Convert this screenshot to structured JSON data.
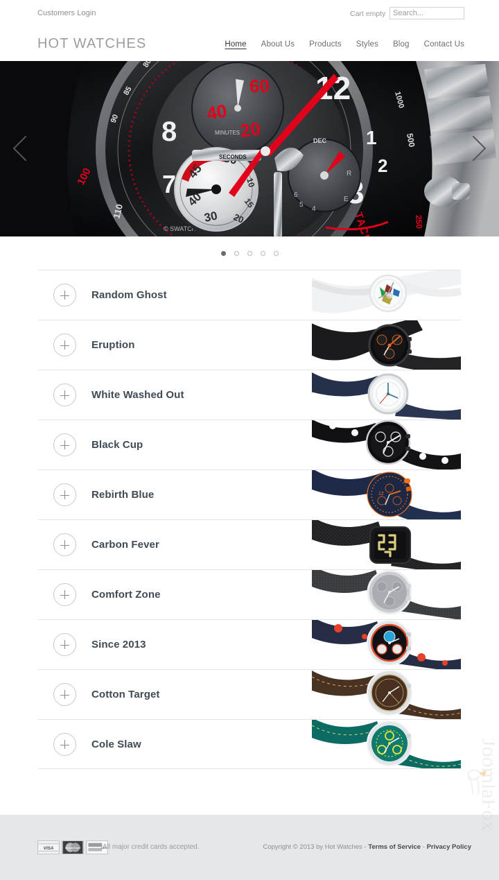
{
  "topbar": {
    "customers_login": "Customers Login",
    "cart_status": "Cart empty",
    "search_placeholder": "Search..."
  },
  "header": {
    "logo": "HOT WATCHES",
    "nav": [
      {
        "label": "Home",
        "active": true
      },
      {
        "label": "About Us",
        "active": false
      },
      {
        "label": "Products",
        "active": false
      },
      {
        "label": "Styles",
        "active": false
      },
      {
        "label": "Blog",
        "active": false
      },
      {
        "label": "Contact Us",
        "active": false
      }
    ]
  },
  "hero": {
    "alt": "chronograph-watch-closeup",
    "prev_label": "Previous slide",
    "next_label": "Next slide",
    "slide_count": 5,
    "active_slide": 1
  },
  "products": [
    {
      "title": "Random Ghost",
      "thumb": "white-transparent-swatch"
    },
    {
      "title": "Eruption",
      "thumb": "black-orange-chrono"
    },
    {
      "title": "White Washed Out",
      "thumb": "white-blue-dial"
    },
    {
      "title": "Black Cup",
      "thumb": "black-dotted-strap"
    },
    {
      "title": "Rebirth Blue",
      "thumb": "navy-orange-chrono"
    },
    {
      "title": "Carbon Fever",
      "thumb": "carbon-digital-lcd"
    },
    {
      "title": "Comfort Zone",
      "thumb": "grey-silver-chrono"
    },
    {
      "title": "Since 2013",
      "thumb": "denim-red-dots"
    },
    {
      "title": "Cotton Target",
      "thumb": "brown-leather-dial"
    },
    {
      "title": "Cole Slaw",
      "thumb": "teal-yellow-dial"
    }
  ],
  "footer": {
    "cards": [
      "VISA",
      "MasterCard",
      "AmEx"
    ],
    "cards_text": "All major credit cards accepted.",
    "copyright_prefix": "Copyright © 2013 by Hot Watches - ",
    "terms_label": "Terms of Service",
    "separator": " - ",
    "privacy_label": "Privacy Policy",
    "watermark": "JoomlaFox"
  },
  "colors": {
    "accent_red": "#e2001a",
    "footer_bg": "#e6e7e9",
    "divider": "#e4e4e4",
    "title_text": "#3f4a54",
    "watermark_orange": "#f5920b"
  }
}
